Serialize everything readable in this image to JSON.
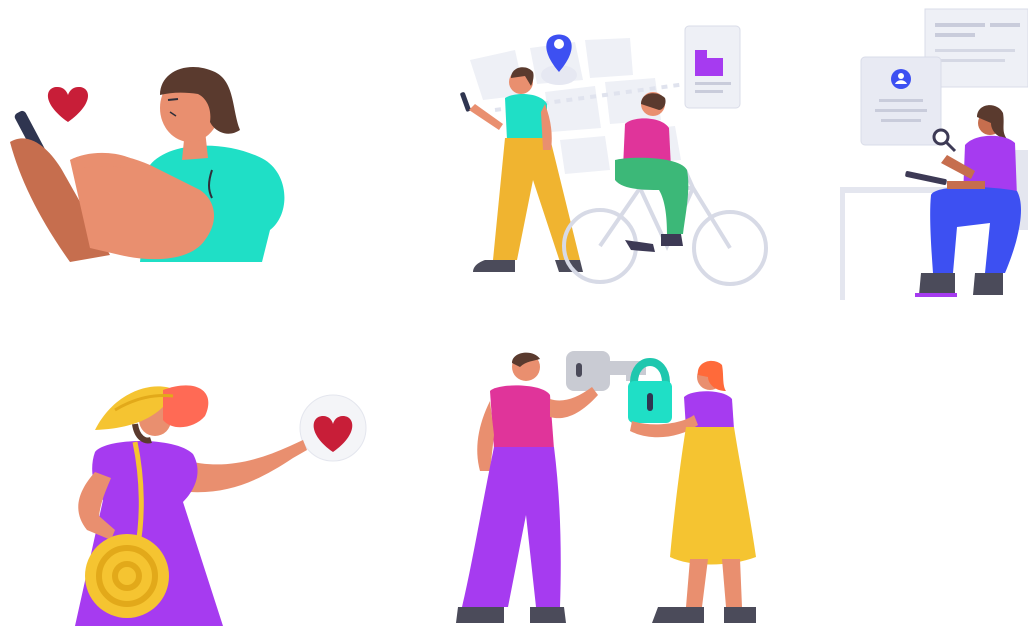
{
  "page": {
    "background": "#ffffff"
  },
  "illustrations": [
    {
      "name": "person-texting-with-heart",
      "icons": [
        "phone-icon",
        "heart-icon"
      ]
    },
    {
      "name": "people-walking-and-cycling-on-map",
      "icons": [
        "map-pin-icon",
        "building-card-icon",
        "bicycle-icon",
        "phone-icon"
      ]
    },
    {
      "name": "person-reviewing-profile-documents",
      "icons": [
        "profile-card-icon",
        "document-icon",
        "magnifier-icon",
        "tablet-icon"
      ]
    },
    {
      "name": "person-with-sun-hat-pointing-to-heart",
      "icons": [
        "heart-bubble-icon",
        "round-bag-icon",
        "sun-hat-icon"
      ]
    },
    {
      "name": "people-exchanging-key-and-padlock",
      "icons": [
        "key-icon",
        "padlock-icon"
      ]
    }
  ],
  "palette": {
    "skin": "#E98F6F",
    "skin_dark": "#C66E4E",
    "hair": "#5A3A2E",
    "teal": "#1FDFC6",
    "purple": "#A63BF0",
    "magenta": "#E0349A",
    "yellow": "#F5C431",
    "heart": "#C81E38",
    "blue": "#3D50F2",
    "green": "#3CB878",
    "ui_gray": "#E8EAF3",
    "shoe": "#4B4B5A"
  }
}
